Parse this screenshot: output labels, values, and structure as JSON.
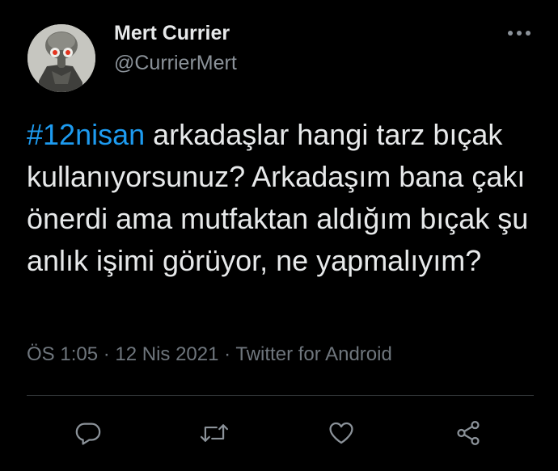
{
  "author": {
    "display_name": "Mert Currier",
    "handle": "@CurrierMert",
    "avatar_icon": "squidward-avatar"
  },
  "tweet": {
    "hashtag": "#12nisan",
    "text": " arkadaşlar hangi tarz bıçak kullanıyorsunuz? Arkadaşım bana çakı önerdi ama mutfaktan aldığım bıçak şu anlık işimi görüyor, ne yapmalıyım?"
  },
  "meta": {
    "time": "ÖS 1:05",
    "sep1": " · ",
    "date": "12 Nis 2021",
    "sep2": " · ",
    "source": "Twitter for Android"
  },
  "actions": [
    "reply-icon",
    "retweet-icon",
    "like-icon",
    "share-icon"
  ],
  "colors": {
    "background": "#000000",
    "text": "#e7e9ea",
    "muted": "#6f767d",
    "link": "#1d9bf0",
    "divider": "#2f3336"
  }
}
